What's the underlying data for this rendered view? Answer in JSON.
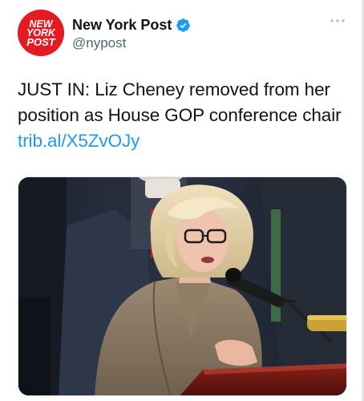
{
  "account": {
    "display_name": "New York Post",
    "handle": "@nypost",
    "logo_text": "NEW YORK POST"
  },
  "tweet": {
    "text_plain": "JUST IN: Liz Cheney removed from her position as House GOP conference chair ",
    "link_text": "trib.al/X5ZvOJy"
  },
  "icons": {
    "verified": "verified-badge-icon",
    "more": "more-options-icon"
  },
  "colors": {
    "brand_red": "#e41b23",
    "verified_blue": "#1d9bf0",
    "link_blue": "#1d9bf0",
    "text": "#0f1419",
    "secondary_text": "#536471"
  }
}
